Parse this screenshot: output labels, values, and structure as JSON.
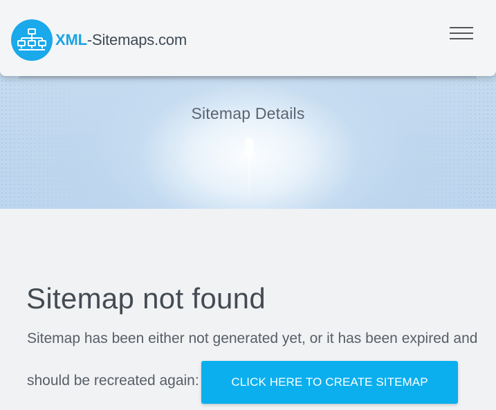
{
  "header": {
    "logo": {
      "text_strong": "XML",
      "text_rest": "-Sitemaps.com",
      "icon": "sitemap-icon",
      "icon_color": "#1aa9ea"
    },
    "menu_icon": "hamburger-menu-icon"
  },
  "hero": {
    "title": "Sitemap Details"
  },
  "main": {
    "title": "Sitemap not found",
    "message_line1": "Sitemap has been either not generated yet, or it has been expired and",
    "message_line2": "should be recreated again:",
    "button_label": "CLICK HERE TO CREATE SITEMAP",
    "button_color": "#0bafee"
  }
}
